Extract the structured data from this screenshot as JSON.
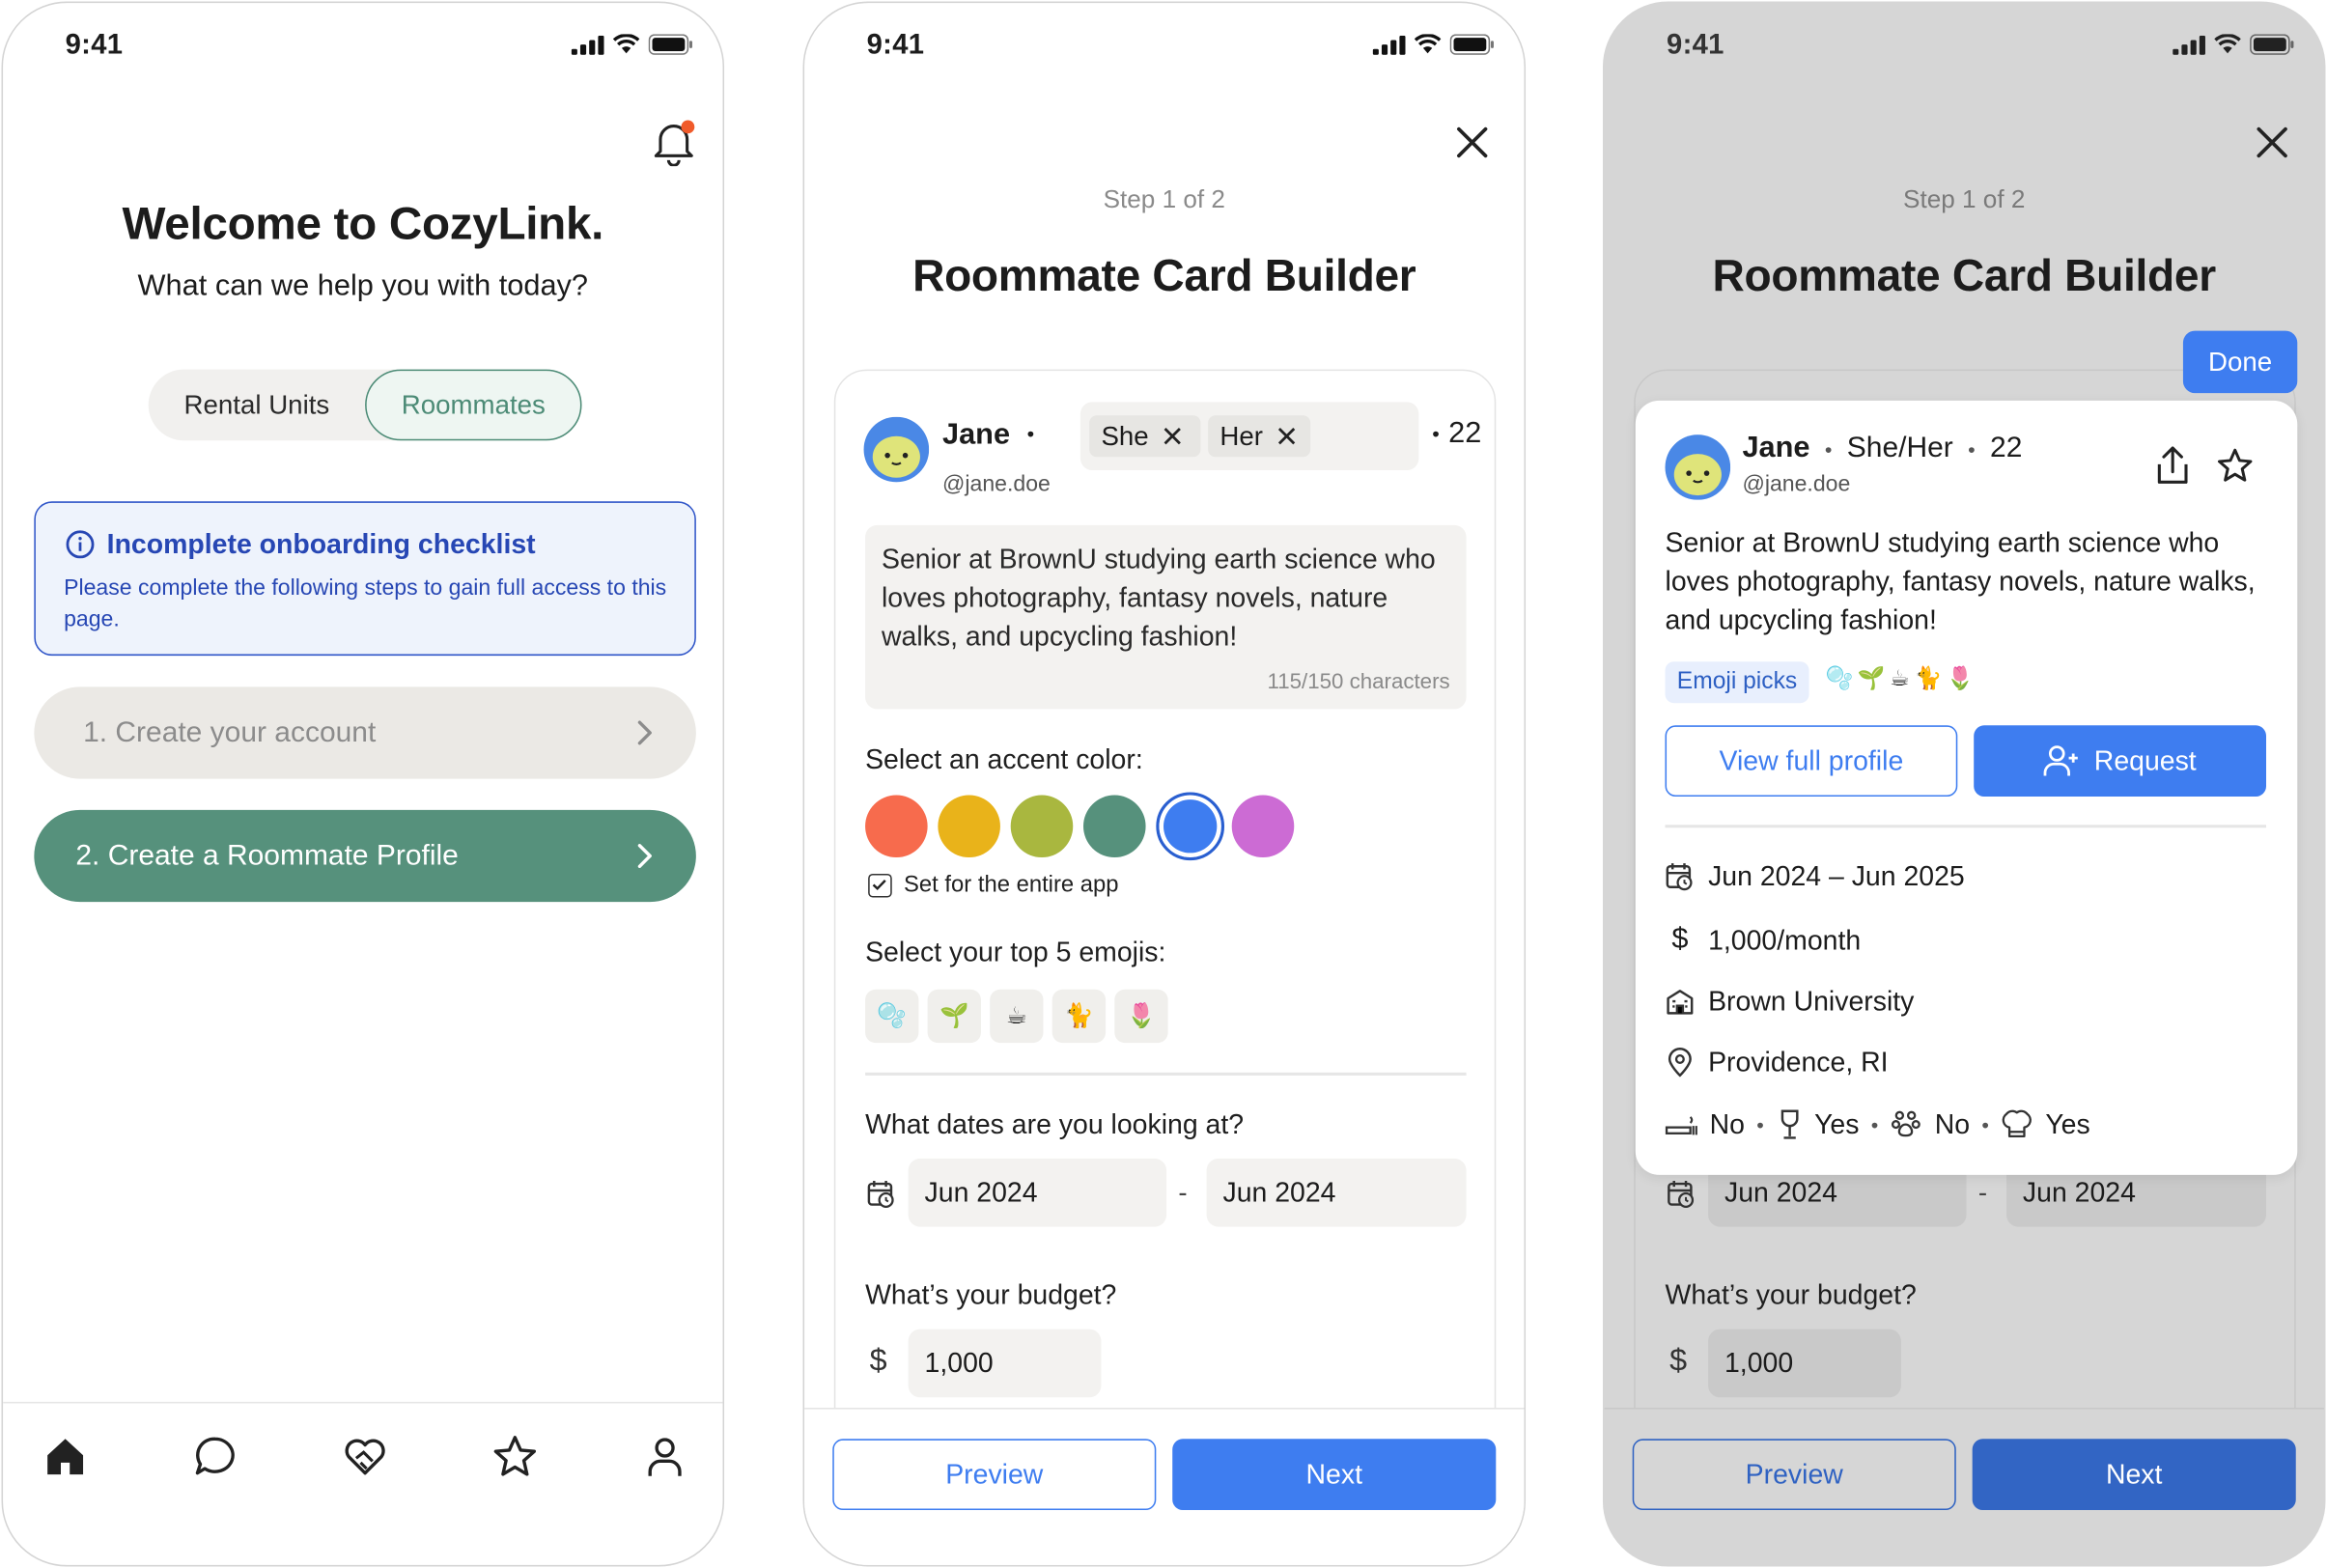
{
  "status": {
    "time": "9:41"
  },
  "home": {
    "title": "Welcome to CozyLink.",
    "subtitle": "What can we help you with today?",
    "segments": [
      "Rental Units",
      "Roommates"
    ],
    "alert": {
      "title": "Incomplete onboarding checklist",
      "body": "Please complete the following steps to gain full access to this page."
    },
    "steps": [
      "1. Create your account",
      "2. Create a Roommate Profile"
    ]
  },
  "builder": {
    "step_label": "Step 1 of 2",
    "title": "Roommate Card Builder",
    "name": "Jane",
    "handle": "@jane.doe",
    "pronouns": [
      "She",
      "Her"
    ],
    "age": "22",
    "bio": "Senior at BrownU studying earth science who loves photography, fantasy novels, nature walks, and upcycling fashion!",
    "char_count": "115/150 characters",
    "accent_label": "Select an accent color:",
    "accent_colors": [
      "#f76b4d",
      "#e9b31a",
      "#a9b73f",
      "#56917c",
      "#3e7df0",
      "#cc6bd4"
    ],
    "selected_accent": "#3e7df0",
    "set_app_label": "Set for the entire app",
    "emoji_label": "Select your top 5 emojis:",
    "emojis": [
      "🫧",
      "🌱",
      "☕",
      "🐈",
      "🌷"
    ],
    "dates_label": "What dates are you looking at?",
    "date_from": "Jun 2024",
    "date_to": "Jun 2024",
    "date_separator": "-",
    "budget_label": "What’s your budget?",
    "budget_symbol": "$",
    "budget": "1,000",
    "preview_label": "Preview",
    "next_label": "Next"
  },
  "preview": {
    "done_label": "Done",
    "pronouns": "She/Her",
    "emoji_picks_label": "Emoji picks",
    "view_profile_label": "View full profile",
    "request_label": "Request",
    "dates": "Jun 2024 – Jun 2025",
    "budget": "1,000/month",
    "school": "Brown University",
    "location": "Providence, RI",
    "habits": [
      "No",
      "Yes",
      "No",
      "Yes"
    ]
  },
  "tabs": [
    "home-icon",
    "chat-icon",
    "heart-handshake-icon",
    "star-icon",
    "profile-icon"
  ]
}
